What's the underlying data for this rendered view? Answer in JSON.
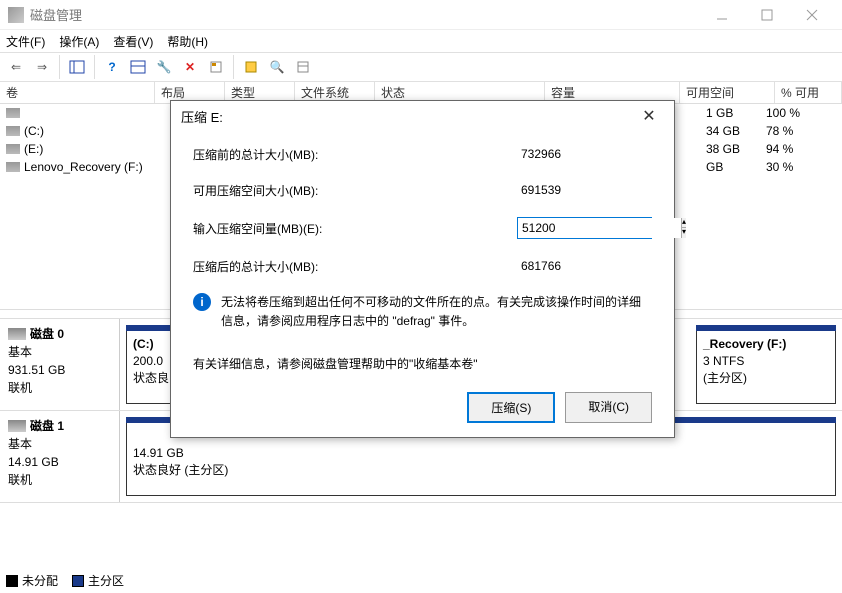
{
  "window": {
    "title": "磁盘管理"
  },
  "menu": {
    "file": "文件(F)",
    "action": "操作(A)",
    "view": "查看(V)",
    "help": "帮助(H)"
  },
  "columns": {
    "volume": "卷",
    "layout": "布局",
    "type": "类型",
    "fs": "文件系统",
    "status": "状态",
    "capacity": "容量",
    "free": "可用空间",
    "pct": "% 可用"
  },
  "volumes": [
    {
      "name": "",
      "free": "1 GB",
      "pct": "100 %"
    },
    {
      "name": "(C:)",
      "free": "34 GB",
      "pct": "78 %"
    },
    {
      "name": "(E:)",
      "free": "38 GB",
      "pct": "94 %"
    },
    {
      "name": "Lenovo_Recovery (F:)",
      "free": "GB",
      "pct": "30 %"
    }
  ],
  "disk0": {
    "name": "磁盘 0",
    "type": "基本",
    "size": "931.51 GB",
    "status": "联机",
    "p1": {
      "name": "(C:)",
      "size": "200.0",
      "status": "状态良"
    },
    "p2": {
      "name": "_Recovery  (F:)",
      "fs": "3 NTFS",
      "status": "(主分区)"
    }
  },
  "disk1": {
    "name": "磁盘 1",
    "type": "基本",
    "size": "14.91 GB",
    "status": "联机",
    "p1": {
      "size": "14.91 GB",
      "status": "状态良好 (主分区)"
    }
  },
  "legend": {
    "unalloc": "未分配",
    "primary": "主分区"
  },
  "dialog": {
    "title": "压缩 E:",
    "l_total_before": "压缩前的总计大小(MB):",
    "v_total_before": "732966",
    "l_avail": "可用压缩空间大小(MB):",
    "v_avail": "691539",
    "l_input": "输入压缩空间量(MB)(E):",
    "v_input": "51200",
    "l_total_after": "压缩后的总计大小(MB):",
    "v_total_after": "681766",
    "info": "无法将卷压缩到超出任何不可移动的文件所在的点。有关完成该操作时间的详细信息，请参阅应用程序日志中的 \"defrag\" 事件。",
    "link": "有关详细信息，请参阅磁盘管理帮助中的\"收缩基本卷\"",
    "btn_shrink": "压缩(S)",
    "btn_cancel": "取消(C)"
  }
}
